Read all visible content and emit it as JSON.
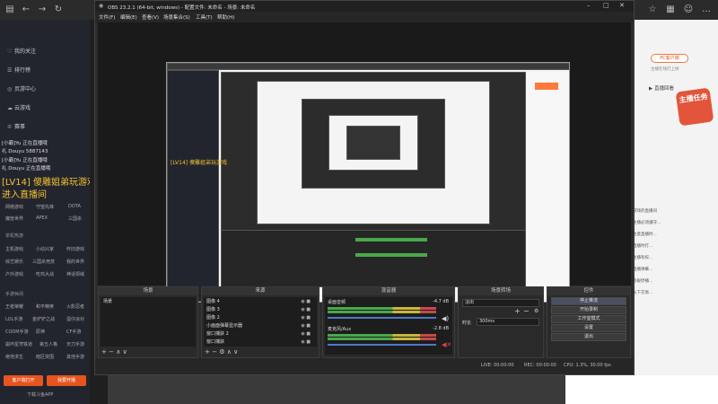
{
  "obs": {
    "title": "OBS 23.2.1 (64-bit, windows) - 配置文件: 未命名 - 场景: 未命名",
    "menu": [
      "文件(F)",
      "编辑(E)",
      "查看(V)",
      "场景集合(S)",
      "工具(T)",
      "帮助(H)"
    ],
    "docks": {
      "scenes": {
        "title": "场景",
        "items": [
          "场景"
        ]
      },
      "sources": {
        "title": "来源",
        "items": [
          "图像 4",
          "图像 3",
          "图像 2",
          "小画面弹幕显示器",
          "窗口捕获 2",
          "窗口捕获"
        ]
      },
      "mixer": {
        "title": "混音器",
        "channels": [
          {
            "name": "桌面音频",
            "db": "-4.7 dB"
          },
          {
            "name": "麦克风/Aux",
            "db": "-2.8 dB"
          }
        ]
      },
      "transitions": {
        "title": "场景转场",
        "type": "淡出",
        "duration_label": "时长",
        "duration_value": "300ms"
      },
      "controls": {
        "title": "控件",
        "buttons": [
          "停止推流",
          "开始录制",
          "工作室模式",
          "设置",
          "退出"
        ]
      }
    },
    "status": {
      "live": "LIVE: 00:00:00",
      "rec": "REC: 00:00:00",
      "cpu": "CPU: 1.3%, 30.00 fps"
    }
  },
  "site": {
    "nav": [
      "我的关注",
      "排行榜",
      "页游中心",
      "云游戏",
      "赛事"
    ],
    "chat": [
      "[小霸]Yu 正在直播哦",
      "礼 Douyu 5887143",
      "[小霸]Yu 正在直播哦",
      "礼 Douyu 正在直播哦"
    ],
    "stream_title_1": "[LV14] 傻雕姐弟玩游戏",
    "stream_title_2": "进入直播间",
    "grid_a": [
      "网络游戏",
      "守望先锋",
      "DOTA",
      "魔兽世界",
      "APEX",
      "三国杀"
    ],
    "section_mobile": "单机热游",
    "grid_b": [
      "主机游戏",
      "小幼兴家",
      "怀旧游戏",
      "综艺娱乐",
      "三国杀竞技",
      "我的世界",
      "户外游戏",
      "吃鸡大战",
      "神话领域"
    ],
    "section_mobile2": "手游休闲",
    "grid_c": [
      "王者荣耀",
      "和平精英",
      "火影忍者",
      "LOL手游",
      "金铲铲之战",
      "蛋仔派对",
      "CODM手游",
      "原神",
      "CF手游",
      "崩坏星穹铁道",
      "第五人格",
      "天刀手游",
      "绝地求生",
      "暗区突围",
      "其他手游"
    ],
    "buttons": [
      "客户端打开",
      "我要开播"
    ],
    "bottom_link": "下载斗鱼APP"
  },
  "right": {
    "badge": "PC客户端",
    "badge_sub": "主播在线打上榜",
    "item": "直播回看",
    "promo": "主播任务",
    "lines": [
      "游戏的直播间",
      "主播必须遵守...",
      "注意直播时...",
      "直播时打...",
      "主播有权...",
      "直播弹幕...",
      "违规停播...",
      "私下交易..."
    ]
  }
}
